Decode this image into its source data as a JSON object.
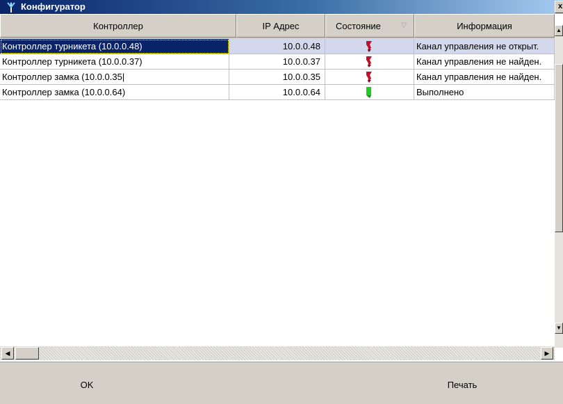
{
  "window": {
    "title": "Конфигуратор",
    "close_glyph": "x",
    "app_icon": "antenna-icon"
  },
  "table": {
    "columns": [
      "Контроллер",
      "IP Адрес",
      "Состояние",
      "Информация"
    ],
    "sort_column": "Состояние",
    "rows": [
      {
        "controller": "Контроллер турникета (10.0.0.48)",
        "ip": "10.0.0.48",
        "status": "error",
        "info": "Канал управления не открыт.",
        "selected": true
      },
      {
        "controller": "Контроллер турникета (10.0.0.37)",
        "ip": "10.0.0.37",
        "status": "error",
        "info": "Канал управления не найден.",
        "selected": false
      },
      {
        "controller": "Контроллер замка  (10.0.0.35|",
        "ip": "10.0.0.35",
        "status": "error",
        "info": "Канал управления не найден.",
        "selected": false
      },
      {
        "controller": "Контроллер замка  (10.0.0.64)",
        "ip": "10.0.0.64",
        "status": "ok",
        "info": "Выполнено",
        "selected": false
      }
    ]
  },
  "colors": {
    "status_error": "#c0102a",
    "status_ok": "#22cc22",
    "selection": "#0a246a"
  },
  "footer": {
    "ok_label": "OK",
    "print_label": "Печать"
  }
}
